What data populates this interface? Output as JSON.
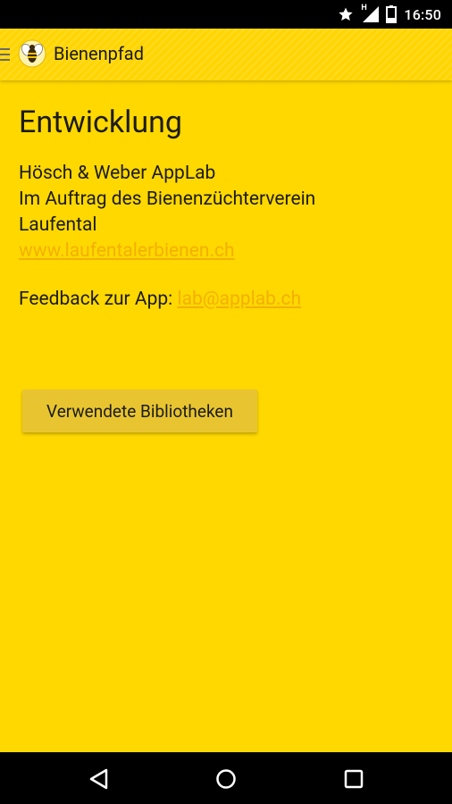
{
  "status_bar": {
    "time": "16:50",
    "network_label": "H",
    "icons": [
      "star-icon",
      "signal-icon",
      "battery-icon"
    ]
  },
  "app_bar": {
    "title": "Bienenpfad",
    "menu_icon": "hamburger-menu-icon",
    "logo_icon": "bee-logo-icon"
  },
  "content": {
    "heading": "Entwicklung",
    "company": "Hösch & Weber AppLab",
    "commission_line1": "Im Auftrag des Bienenzüchterverein",
    "commission_line2": "Laufental",
    "website_link": "www.laufentalerbienen.ch",
    "feedback_label": "Feedback zur App: ",
    "feedback_email": "lab@applab.ch",
    "libraries_button": "Verwendete Bibliotheken"
  },
  "nav_bar": {
    "icons": [
      "back-icon",
      "home-icon",
      "recents-icon"
    ]
  },
  "colors": {
    "app_bar": "#FFD500",
    "background": "#FFD800",
    "link": "#F3B000",
    "button": "#E8C530"
  }
}
